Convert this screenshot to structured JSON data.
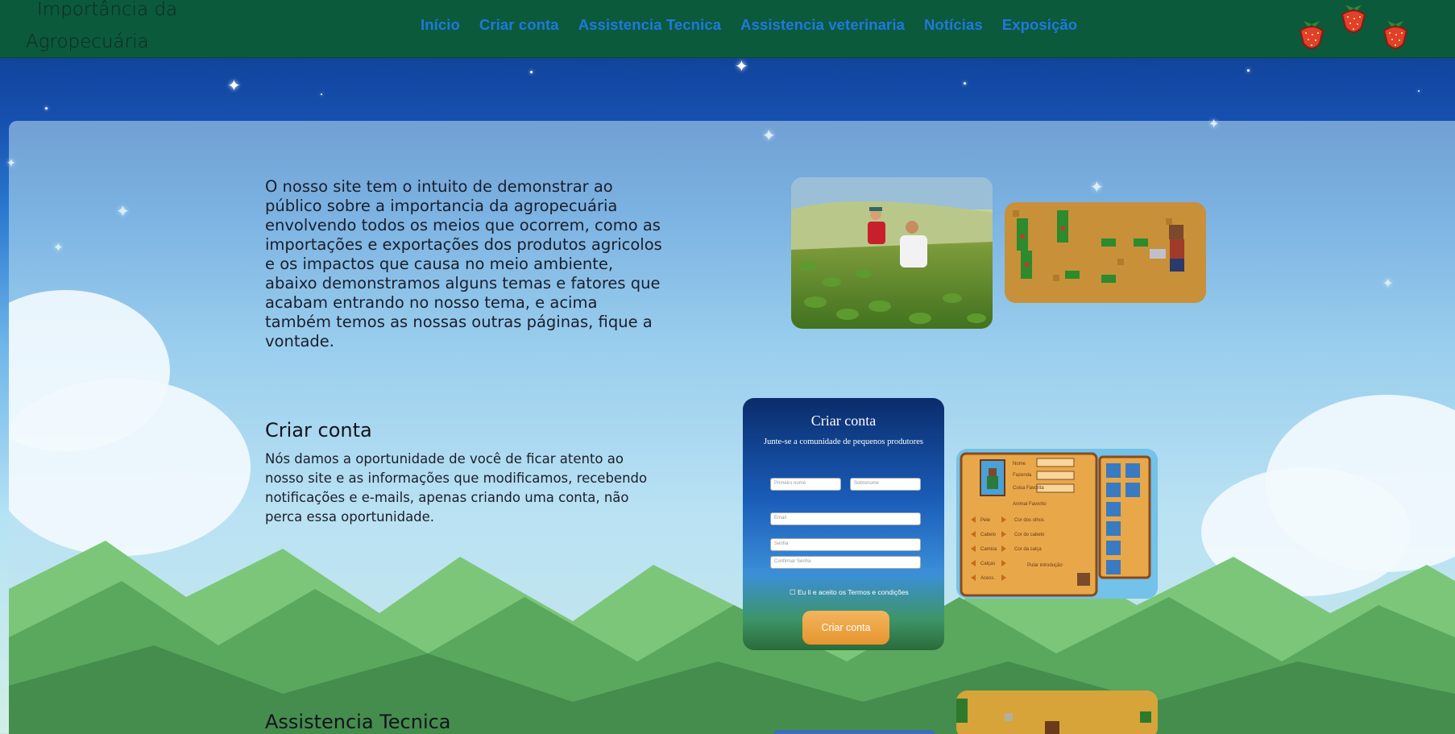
{
  "header": {
    "brand_line1": "Importância da",
    "brand_line2": "Agropecuária",
    "nav": [
      "Início",
      "Criar conta",
      "Assistencia Tecnica",
      "Assistencia veterinaria",
      "Notícias",
      "Exposição"
    ]
  },
  "intro": {
    "text": "O nosso site tem o intuito de demonstrar ao público sobre a importancia da agropecuária envolvendo todos os meios que ocorrem, como as importações e exportações dos produtos agricolos e os impactos que causa no meio ambiente, abaixo demonstramos alguns temas e fatores que acabam entrando no nosso tema, e acima também temos as nossas outras páginas, fique a vontade."
  },
  "sections": {
    "criar_conta": {
      "title": "Criar conta",
      "text": "Nós damos a oportunidade de você de ficar atento ao nosso site e as informações que modificamos, recebendo notificações e e-mails, apenas criando uma conta, não perca essa oportunidade."
    },
    "assistencia": {
      "title": "Assistencia Tecnica"
    }
  },
  "form_preview": {
    "title": "Criar conta",
    "subtitle": "Junte-se a comunidade de pequenos produtores",
    "first_name": "Primeiro nome",
    "last_name": "Sobrenome",
    "email": "Email",
    "password": "Senha",
    "confirm": "Confirmar Senha",
    "terms": "Eu li e aceito os Termos e condições",
    "button": "Criar conta"
  },
  "game_ui": {
    "labels": [
      "Nome",
      "Fazenda",
      "Coisa Favorita",
      "Animal Favorito",
      "Pele",
      "Cabelo",
      "Camisa",
      "Calças",
      "Acess.",
      "Cor dos olhos",
      "Cor do cabelo",
      "Cor da calça",
      "Pular introdução"
    ]
  },
  "colors": {
    "header_bg": "#0b5a3c",
    "nav_link": "#1f78e0",
    "sky_top": "#0c3a8a",
    "button_orange": "#e6952e"
  }
}
